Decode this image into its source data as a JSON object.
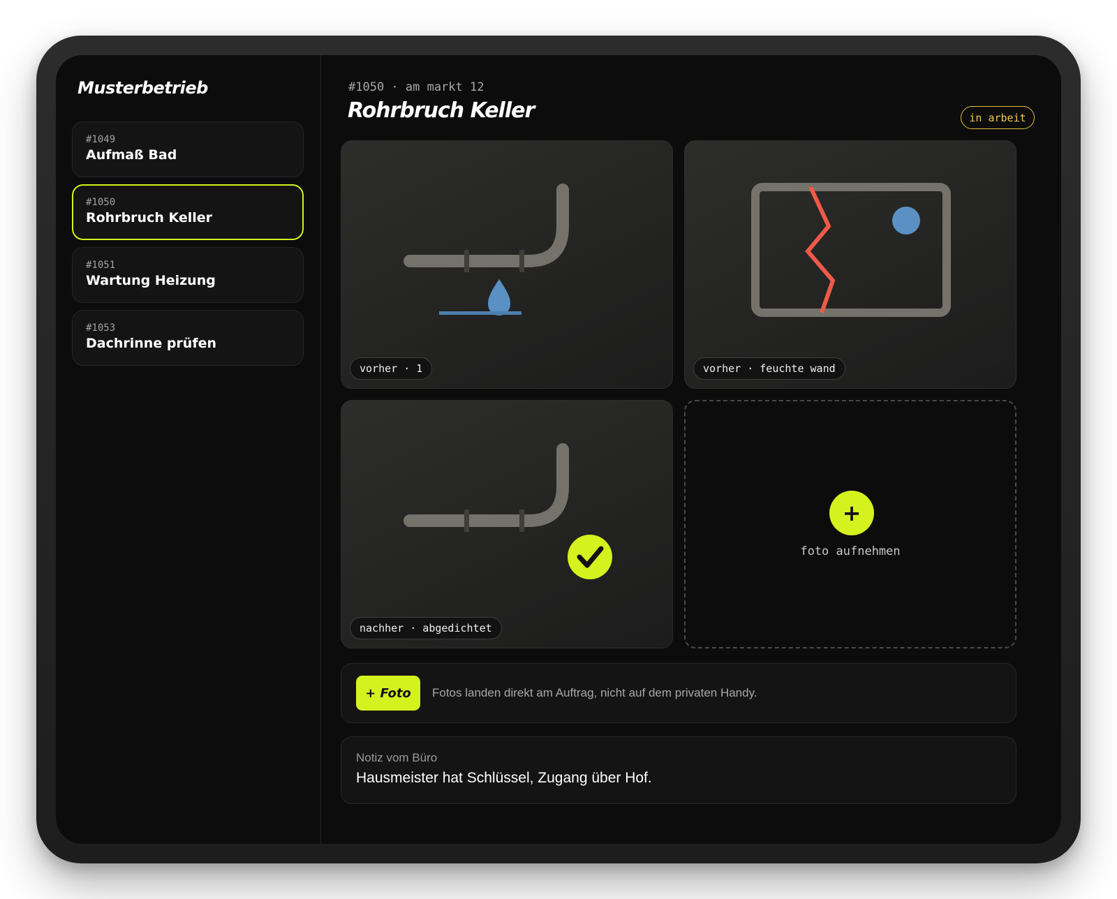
{
  "sidebar": {
    "brand": "Musterbetrieb",
    "jobs": [
      {
        "number": "#1049",
        "title": "Aufmaß Bad",
        "active": false
      },
      {
        "number": "#1050",
        "title": "Rohrbruch Keller",
        "active": true
      },
      {
        "number": "#1051",
        "title": "Wartung Heizung",
        "active": false
      },
      {
        "number": "#1053",
        "title": "Dachrinne prüfen",
        "active": false
      }
    ]
  },
  "header": {
    "subtitle": "#1050 · am markt 12",
    "title": "Rohrbruch Keller",
    "status": "in arbeit"
  },
  "photos": [
    {
      "caption": "vorher · 1",
      "icon": "leaking-pipe-icon"
    },
    {
      "caption": "vorher · feuchte wand",
      "icon": "cracked-wall-icon"
    },
    {
      "caption": "nachher · abgedichtet",
      "icon": "sealed-pipe-icon"
    }
  ],
  "add_photo": {
    "icon": "+",
    "label": "foto aufnehmen"
  },
  "action_bar": {
    "button_label": "+ Foto",
    "hint": "Fotos landen direkt am Auftrag, nicht auf dem privaten Handy."
  },
  "note": {
    "label": "Notiz vom Büro",
    "text": "Hausmeister hat Schlüssel, Zugang über Hof."
  },
  "colors": {
    "accent": "#d4f21d",
    "status": "#f2c94c",
    "water": "#5b90c4",
    "crack": "#ee5a48",
    "pipe": "#74726b"
  }
}
